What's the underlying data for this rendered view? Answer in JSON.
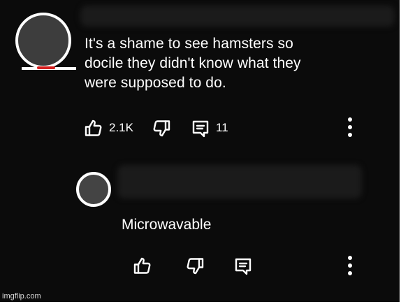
{
  "comment": {
    "text_lines": [
      "It's a shame to see hamsters so",
      "docile they didn't know what they",
      "were supposed to do."
    ],
    "like_count": "2.1K",
    "reply_count": "11"
  },
  "reply": {
    "text": "Microwavable"
  },
  "icons": {
    "like": "thumbs-up-icon",
    "dislike": "thumbs-down-icon",
    "reply": "reply-icon",
    "more": "more-vertical-icon"
  },
  "watermark": "imgflip.com",
  "colors": {
    "background": "#0b0b0b",
    "text": "#ffffff",
    "avatar_accent": "#d61f1f"
  }
}
